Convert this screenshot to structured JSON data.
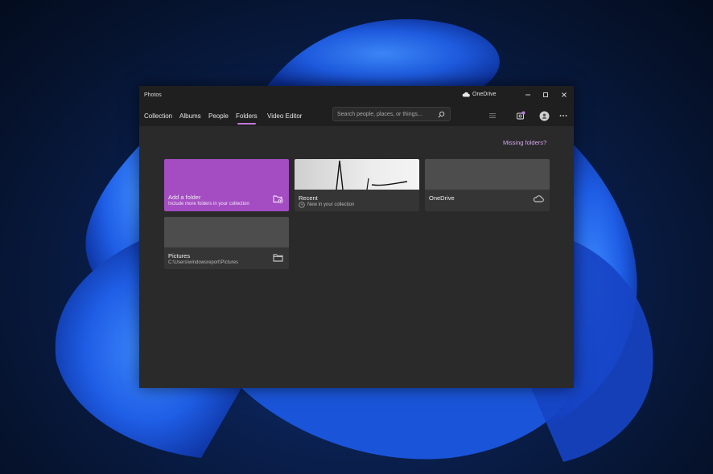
{
  "window": {
    "title": "Photos",
    "onedrive_label": "OneDrive"
  },
  "nav": {
    "tabs": [
      {
        "label": "Collection"
      },
      {
        "label": "Albums"
      },
      {
        "label": "People"
      },
      {
        "label": "Folders",
        "active": true
      },
      {
        "label": "Video Editor"
      }
    ]
  },
  "search": {
    "placeholder": "Search people, places, or things..."
  },
  "missing_folders_link": "Missing folders?",
  "cards": {
    "add": {
      "title": "Add a folder",
      "subtitle": "Include more folders in your collection",
      "icon": "add-folder-icon"
    },
    "recent": {
      "title": "Recent",
      "subtitle": "New in your collection",
      "icon": "clock-icon"
    },
    "onedrive": {
      "title": "OneDrive",
      "icon": "cloud-icon"
    },
    "pictures": {
      "title": "Pictures",
      "subtitle": "C:\\Users\\windowsreport\\Pictures",
      "icon": "folder-icon"
    }
  },
  "colors": {
    "accent": "#c07ad9",
    "add_card": "#a44cc2",
    "window_bg": "#2b2a2b",
    "titlebar_bg": "#201f20"
  }
}
